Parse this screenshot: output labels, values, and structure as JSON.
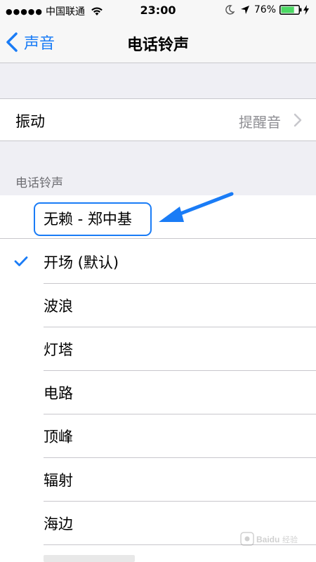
{
  "status_bar": {
    "signal_dots": "●●●●●",
    "carrier": "中国联通",
    "time": "23:00",
    "battery_percent": "76%",
    "battery_level": 0.76,
    "icons": [
      "wifi-icon",
      "moon-icon",
      "location-arrow-icon",
      "battery-icon",
      "charging-bolt-icon"
    ]
  },
  "nav": {
    "back_label": "声音",
    "title": "电话铃声"
  },
  "vibration": {
    "label": "振动",
    "value": "提醒音"
  },
  "section": {
    "header": "电话铃声"
  },
  "ringtones": [
    {
      "label": "无赖 - 郑中基",
      "checked": false,
      "highlighted": true
    },
    {
      "label": "开场 (默认)",
      "checked": true
    },
    {
      "label": "波浪",
      "checked": false
    },
    {
      "label": "灯塔",
      "checked": false
    },
    {
      "label": "电路",
      "checked": false
    },
    {
      "label": "顶峰",
      "checked": false
    },
    {
      "label": "辐射",
      "checked": false
    },
    {
      "label": "海边",
      "checked": false
    }
  ],
  "watermark": {
    "text": "Baidu 经验"
  },
  "colors": {
    "accent": "#1a7cf6",
    "background": "#efeff4",
    "separator": "#c8c7cc",
    "secondary_text": "#8e8e93",
    "battery_green": "#4cd964"
  }
}
